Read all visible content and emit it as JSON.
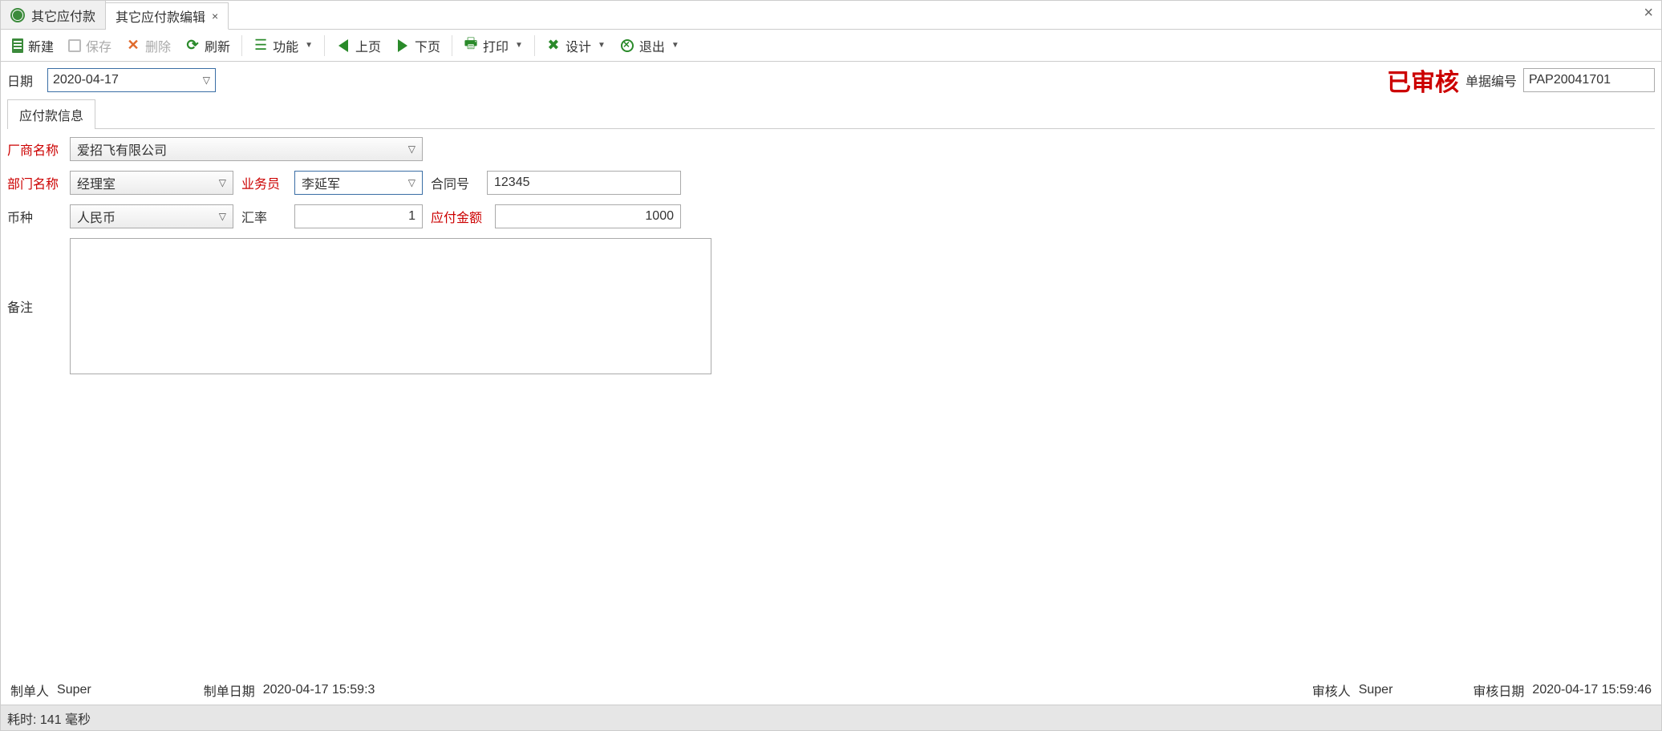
{
  "tabs": {
    "list_tab": "其它应付款",
    "edit_tab": "其它应付款编辑"
  },
  "toolbar": {
    "new": "新建",
    "save": "保存",
    "delete": "删除",
    "refresh": "刷新",
    "function": "功能",
    "prev": "上页",
    "next": "下页",
    "print": "打印",
    "design": "设计",
    "exit": "退出"
  },
  "header": {
    "date_label": "日期",
    "date_value": "2020-04-17",
    "approved_stamp": "已审核",
    "docno_label": "单据编号",
    "docno_value": "PAP20041701"
  },
  "subtab": {
    "payable_info": "应付款信息"
  },
  "form": {
    "vendor_label": "厂商名称",
    "vendor_value": "爱招飞有限公司",
    "dept_label": "部门名称",
    "dept_value": "经理室",
    "sales_label": "业务员",
    "sales_value": "李延军",
    "contract_label": "合同号",
    "contract_value": "12345",
    "currency_label": "币种",
    "currency_value": "人民币",
    "rate_label": "汇率",
    "rate_value": "1",
    "amount_label": "应付金额",
    "amount_value": "1000",
    "remark_label": "备注",
    "remark_value": ""
  },
  "footer": {
    "creator_label": "制单人",
    "creator_value": "Super",
    "create_time_label": "制单日期",
    "create_time_value": "2020-04-17 15:59:3",
    "auditor_label": "审核人",
    "auditor_value": "Super",
    "audit_time_label": "审核日期",
    "audit_time_value": "2020-04-17 15:59:46"
  },
  "status": {
    "elapsed": "耗时: 141 毫秒"
  }
}
